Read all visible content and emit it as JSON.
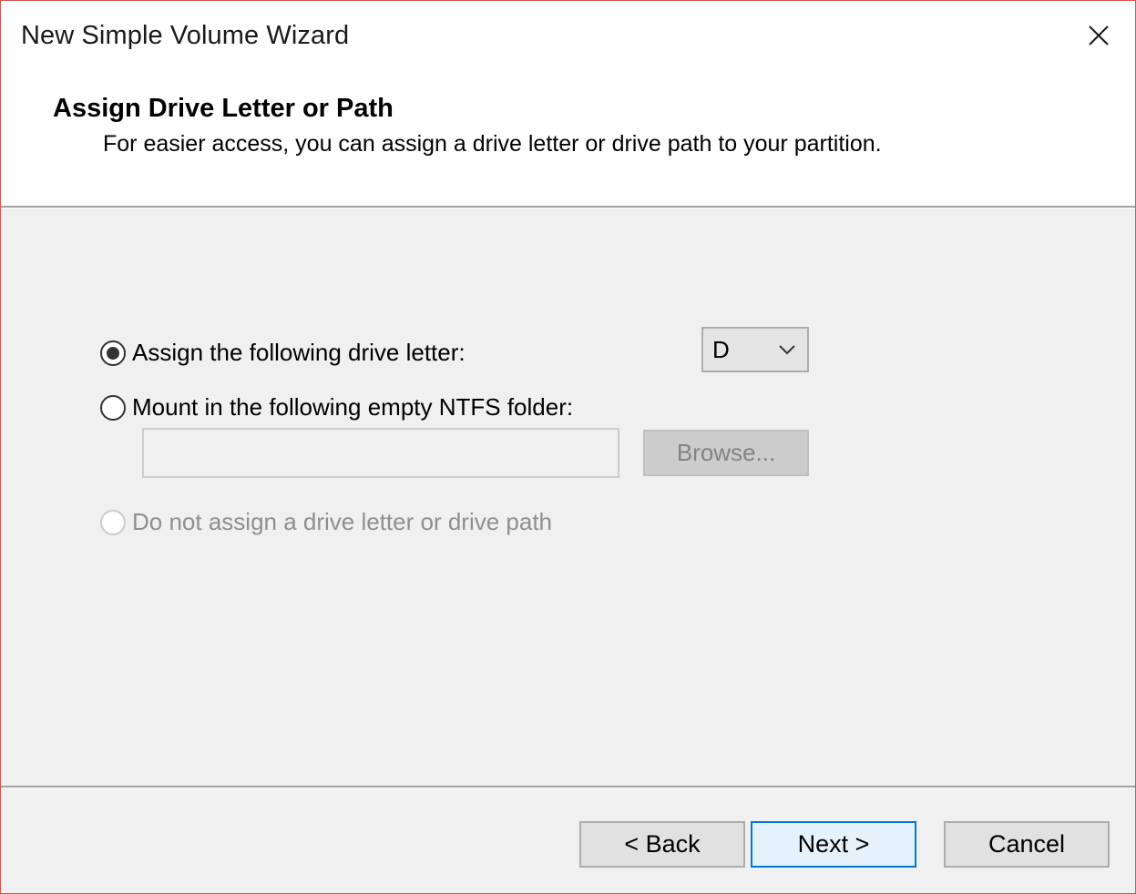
{
  "window": {
    "title": "New Simple Volume Wizard"
  },
  "header": {
    "title": "Assign Drive Letter or Path",
    "subtitle": "For easier access, you can assign a drive letter or drive path to your partition."
  },
  "options": {
    "assign_letter": {
      "label": "Assign the following drive letter:",
      "selected": true,
      "enabled": true
    },
    "mount_folder": {
      "label": "Mount in the following empty NTFS folder:",
      "selected": false,
      "enabled": true
    },
    "no_assign": {
      "label": "Do not assign a drive letter or drive path",
      "selected": false,
      "enabled": false
    }
  },
  "drive_letter": {
    "value": "D"
  },
  "folder_path": {
    "value": "",
    "placeholder": ""
  },
  "browse": {
    "label": "Browse..."
  },
  "footer": {
    "back_label": "< Back",
    "next_label": "Next >",
    "cancel_label": "Cancel"
  },
  "colors": {
    "window_border": "#d9534f",
    "content_bg": "#f0f0f0",
    "default_button_border": "#0078d7",
    "default_button_bg": "#e5f1fb"
  },
  "icons": {
    "close": "close-icon",
    "dropdown": "chevron-down-icon"
  }
}
